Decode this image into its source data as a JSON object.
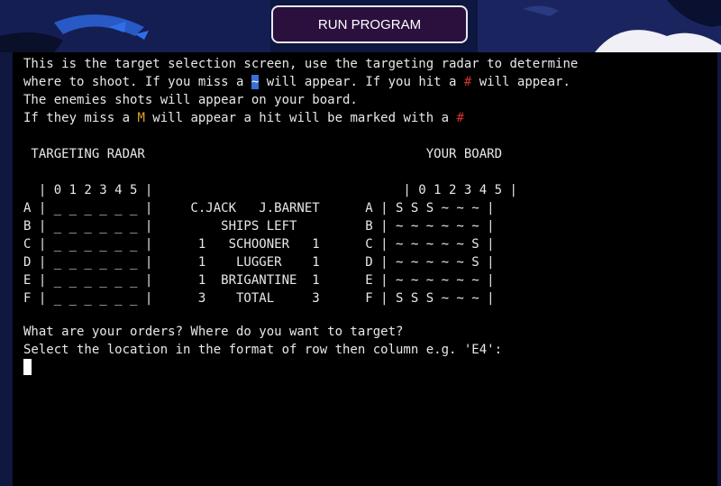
{
  "toolbar": {
    "run_label": "RUN PROGRAM"
  },
  "colors": {
    "terminal_bg": "#000000",
    "terminal_text": "#e8e8e8",
    "miss_marker_highlight": "#3a6fd6",
    "hit_marker": "#d23232",
    "miss_marker": "#e3a22a",
    "button_bg": "#2b0f3d"
  },
  "terminal": {
    "intro": {
      "l1": "This is the target selection screen, use the targeting radar to determine",
      "l2_a": "where to shoot. If you miss a ",
      "l2_tilde": "~",
      "l2_b": " will appear. If you hit a ",
      "l2_hash": "#",
      "l2_c": " will appear.",
      "l3": "The enemies shots will appear on your board.",
      "l4_a": "If they miss a ",
      "l4_m": "M",
      "l4_b": " will appear a hit will be marked with a ",
      "l4_hash": "#"
    },
    "board_rows": [
      " TARGETING RADAR                                     YOUR BOARD",
      "",
      "  | 0 1 2 3 4 5 |                                 | 0 1 2 3 4 5 |",
      "A | _ _ _ _ _ _ |     C.JACK   J.BARNET      A | S S S ~ ~ ~ |",
      "B | _ _ _ _ _ _ |         SHIPS LEFT         B | ~ ~ ~ ~ ~ ~ |",
      "C | _ _ _ _ _ _ |      1   SCHOONER   1      C | ~ ~ ~ ~ ~ S |",
      "D | _ _ _ _ _ _ |      1    LUGGER    1      D | ~ ~ ~ ~ ~ S |",
      "E | _ _ _ _ _ _ |      1  BRIGANTINE  1      E | ~ ~ ~ ~ ~ ~ |",
      "F | _ _ _ _ _ _ |      3    TOTAL     3      F | S S S ~ ~ ~ |"
    ],
    "prompt1": "What are your orders? Where do you want to target?",
    "prompt2": "Select the location in the format of row then column e.g. 'E4':"
  }
}
